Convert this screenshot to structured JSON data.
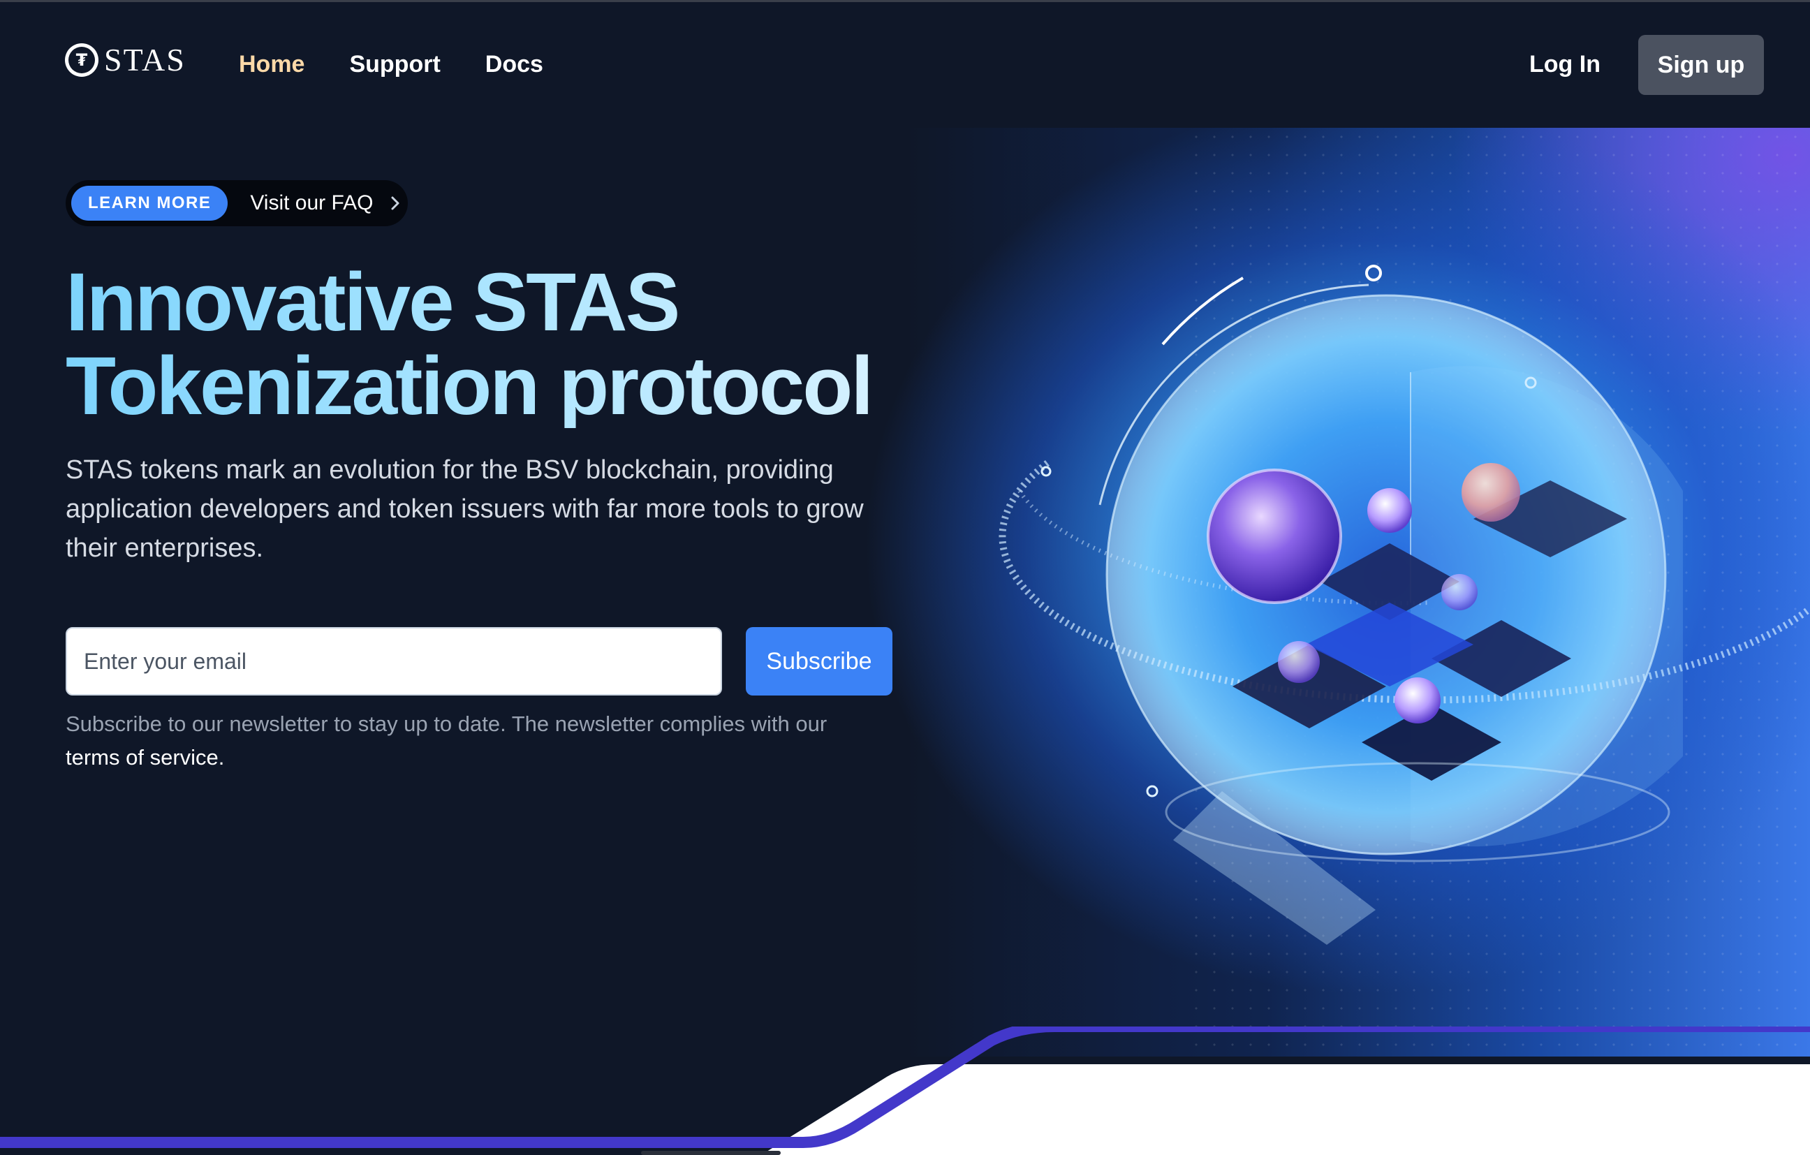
{
  "brand": {
    "logo_glyph": "₮",
    "name": "STAS"
  },
  "nav": {
    "links": [
      {
        "label": "Home",
        "active": true
      },
      {
        "label": "Support",
        "active": false
      },
      {
        "label": "Docs",
        "active": false
      }
    ],
    "login_label": "Log In",
    "signup_label": "Sign up"
  },
  "hero": {
    "badge_label": "LEARN MORE",
    "faq_label": "Visit our FAQ",
    "headline_line1": "Innovative STAS",
    "headline_line2": "Tokenization protocol",
    "description": "STAS tokens mark an evolution for the BSV blockchain, providing application developers and token issuers with far more tools to grow their enterprises.",
    "email_placeholder": "Enter your email",
    "email_value": "",
    "subscribe_label": "Subscribe",
    "note_text": "Subscribe to our newsletter to stay up to date. The newsletter complies with our",
    "tos_label": "terms of service."
  },
  "colors": {
    "background": "#0f1728",
    "accent": "#3b82f6",
    "active_nav": "#fcd9a8",
    "signup_bg": "#4b5260",
    "wave_line": "#4338ca"
  },
  "icons": {
    "faq_chevron": "chevron-right-icon",
    "logo": "tether-coin-icon",
    "hero_art": "crypto-sphere-illustration"
  }
}
